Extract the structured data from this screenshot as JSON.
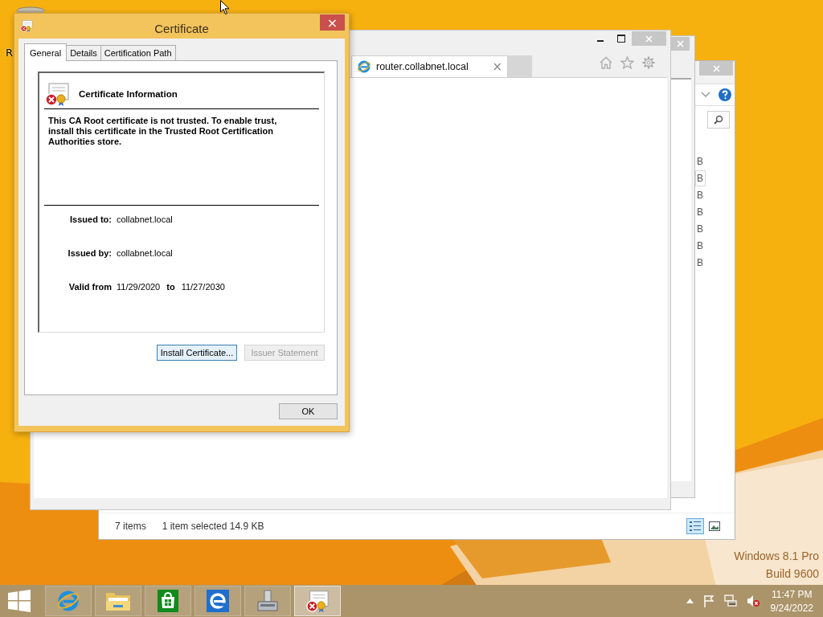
{
  "desktop": {
    "icon_label": "R",
    "watermark": [
      "Windows 8.1 Pro",
      "Build 9600"
    ]
  },
  "explorer": {
    "sizes": [
      {
        "text": "B",
        "selected": false
      },
      {
        "text": "B",
        "selected": true
      },
      {
        "text": "B",
        "selected": false
      },
      {
        "text": "B",
        "selected": false
      },
      {
        "text": "B",
        "selected": false
      },
      {
        "text": "B",
        "selected": false
      },
      {
        "text": "B",
        "selected": false
      }
    ],
    "status_count": "7 items",
    "status_selection": "1 item selected  14.9 KB",
    "views": [
      {
        "kind": "details",
        "selected": true
      },
      {
        "kind": "thumbnails",
        "selected": false
      }
    ]
  },
  "browser": {
    "tab": "router.collabnet.local",
    "tab_close": "×"
  },
  "dialog": {
    "title": "Certificate",
    "close": "×",
    "tabs": [
      {
        "label": "General",
        "selected": true
      },
      {
        "label": "Details",
        "selected": false
      },
      {
        "label": "Certification Path",
        "selected": false
      }
    ],
    "heading": "Certificate Information",
    "message": "This CA Root certificate is not trusted. To enable trust, install this certificate in the Trusted Root Certification Authorities store.",
    "fields": [
      {
        "label": "Issued to:",
        "value": "collabnet.local"
      },
      {
        "label": "Issued by:",
        "value": "collabnet.local"
      }
    ],
    "valid": {
      "label": "Valid from",
      "from": "11/29/2020",
      "to_label": "to",
      "to": "11/27/2030"
    },
    "buttons": [
      {
        "label": "Install Certificate...",
        "disabled": false,
        "focused": true
      },
      {
        "label": "Issuer Statement",
        "disabled": true,
        "focused": false
      }
    ],
    "ok": "OK"
  },
  "taskbar": {
    "apps": [
      {
        "kind": "browser",
        "selected": false
      },
      {
        "kind": "folder",
        "selected": false
      },
      {
        "kind": "store",
        "selected": false
      },
      {
        "kind": "browser-tile",
        "selected": false
      },
      {
        "kind": "server",
        "selected": false
      },
      {
        "kind": "certificate",
        "selected": true
      }
    ],
    "time": "11:47 PM",
    "date": "9/24/2022"
  }
}
